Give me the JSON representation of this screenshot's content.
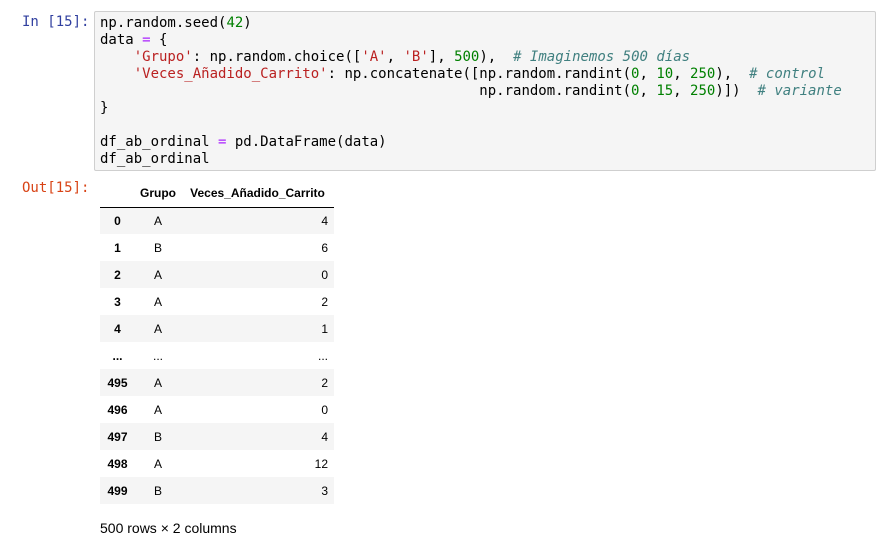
{
  "cell": {
    "in_prompt": "In [15]:",
    "out_prompt": "Out[15]:",
    "code": {
      "l1_a": "np.random.seed(",
      "l1_n": "42",
      "l1_b": ")",
      "l2_a": "data ",
      "l2_eq": "=",
      "l2_b": " {",
      "l3_ind": "    ",
      "l3_s": "'Grupo'",
      "l3_a": ": np.random.choice([",
      "l3_s2": "'A'",
      "l3_c1": ", ",
      "l3_s3": "'B'",
      "l3_b": "], ",
      "l3_n": "500",
      "l3_c": "),  ",
      "l3_cm": "# Imaginemos 500 días",
      "l4_ind": "    ",
      "l4_s": "'Veces_Añadido_Carrito'",
      "l4_a": ": np.concatenate([np.random.randint(",
      "l4_n1": "0",
      "l4_c1": ", ",
      "l4_n2": "10",
      "l4_c2": ", ",
      "l4_n3": "250",
      "l4_b": "),  ",
      "l4_cm": "# control",
      "l5_ind": "                                             ",
      "l5_a": "np.random.randint(",
      "l5_n1": "0",
      "l5_c1": ", ",
      "l5_n2": "15",
      "l5_c2": ", ",
      "l5_n3": "250",
      "l5_b": ")])  ",
      "l5_cm": "# variante",
      "l6": "}",
      "l8_a": "df_ab_ordinal ",
      "l8_eq": "=",
      "l8_b": " pd.DataFrame(data)",
      "l9": "df_ab_ordinal"
    }
  },
  "table": {
    "columns": [
      "Grupo",
      "Veces_Añadido_Carrito"
    ],
    "rows": [
      {
        "index": "0",
        "grupo": "A",
        "veces": "4"
      },
      {
        "index": "1",
        "grupo": "B",
        "veces": "6"
      },
      {
        "index": "2",
        "grupo": "A",
        "veces": "0"
      },
      {
        "index": "3",
        "grupo": "A",
        "veces": "2"
      },
      {
        "index": "4",
        "grupo": "A",
        "veces": "1"
      },
      {
        "index": "...",
        "grupo": "...",
        "veces": "..."
      },
      {
        "index": "495",
        "grupo": "A",
        "veces": "2"
      },
      {
        "index": "496",
        "grupo": "A",
        "veces": "0"
      },
      {
        "index": "497",
        "grupo": "B",
        "veces": "4"
      },
      {
        "index": "498",
        "grupo": "A",
        "veces": "12"
      },
      {
        "index": "499",
        "grupo": "B",
        "veces": "3"
      }
    ],
    "shape": "500 rows × 2 columns"
  }
}
